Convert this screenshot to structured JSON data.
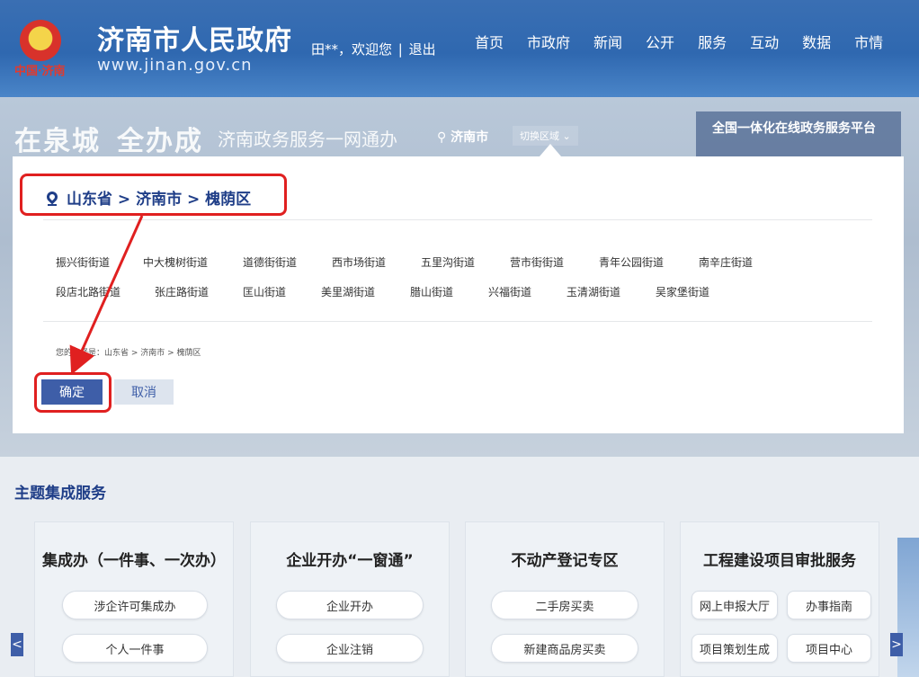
{
  "header": {
    "emblem_sub": "中国·济南",
    "site_title": "济南市人民政府",
    "site_url": "www.jinan.gov.cn",
    "greeting": "田**，欢迎您",
    "separator": "|",
    "logout": "退出",
    "nav": [
      "首页",
      "市政府",
      "新闻",
      "公开",
      "服务",
      "互动",
      "数据",
      "市情"
    ]
  },
  "banner": {
    "slogan_a": "在泉城",
    "slogan_b": "全办成",
    "subtitle": "济南政务服务一网通办",
    "location": "济南市",
    "switch_label": "切换区域",
    "platform_card": "全国一体化在线政务服务平台"
  },
  "dialog": {
    "path": "山东省 > 济南市 > 槐荫区",
    "streets_row1": [
      "振兴街街道",
      "中大槐树街道",
      "道德街街道",
      "西市场街道",
      "五里沟街道",
      "营市街街道",
      "青年公园街道",
      "南辛庄街道"
    ],
    "streets_row2": [
      "段店北路街道",
      "张庄路街道",
      "匡山街道",
      "美里湖街道",
      "腊山街道",
      "兴福街道",
      "玉清湖街道",
      "吴家堡街道"
    ],
    "selected_text": "您的选择是：山东省 > 济南市 > 槐荫区",
    "ok_label": "确定",
    "cancel_label": "取消"
  },
  "services": {
    "section_title": "主题集成服务",
    "cards": [
      {
        "title": "集成办（一件事、一次办）",
        "items": [
          "涉企许可集成办",
          "个人一件事"
        ]
      },
      {
        "title": "企业开办“一窗通”",
        "items": [
          "企业开办",
          "企业注销"
        ]
      },
      {
        "title": "不动产登记专区",
        "items": [
          "二手房买卖",
          "新建商品房买卖"
        ]
      },
      {
        "title": "工程建设项目审批服务",
        "items": [
          "网上申报大厅",
          "办事指南",
          "项目策划生成",
          "项目中心"
        ]
      }
    ],
    "prev_arrow": "<",
    "next_arrow": ">"
  },
  "colors": {
    "header_blue": "#2f68b0",
    "dialog_blue": "#1f3e88",
    "button_blue": "#3e5ea8",
    "highlight_red": "#e02020"
  }
}
